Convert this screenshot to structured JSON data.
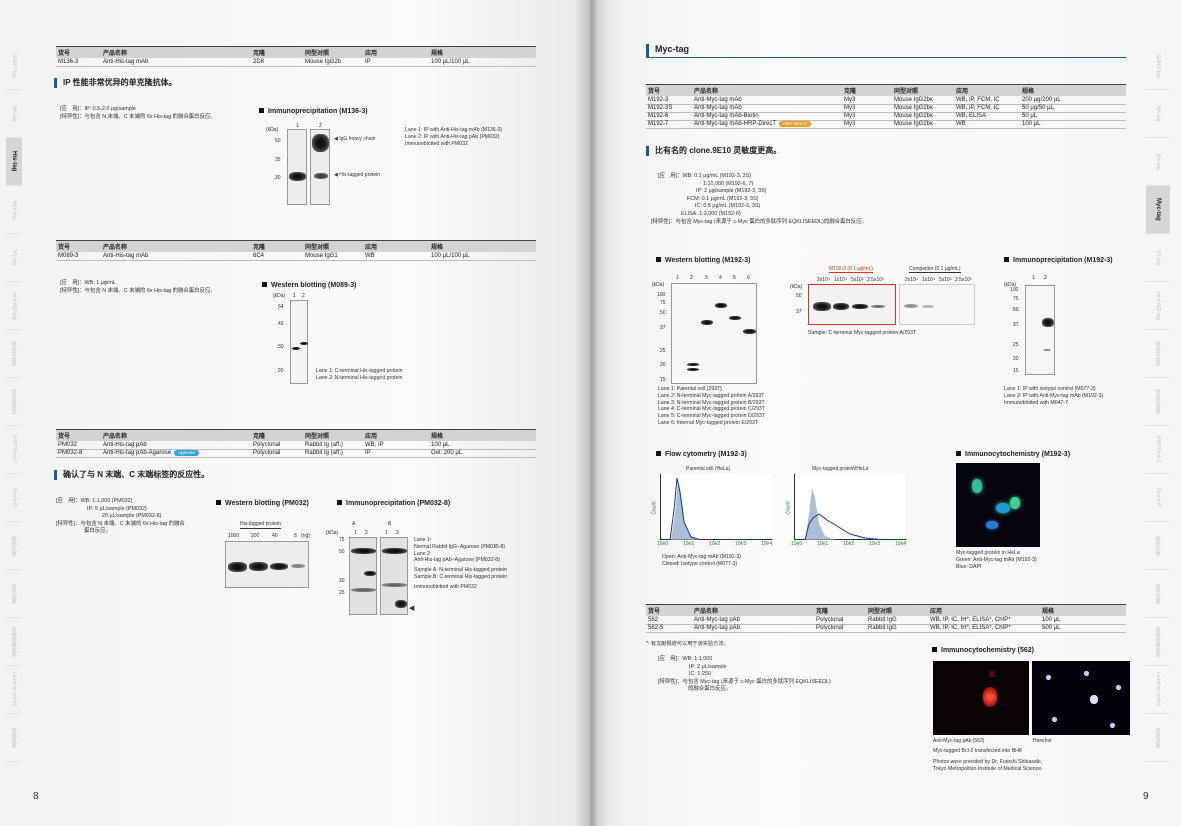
{
  "left_page": {
    "page_number": "8",
    "side_tabs": [
      "SUMO-tag",
      "HA-tag",
      "His-tag",
      "Myc-tag",
      "V5-tag",
      "mini-AID-tag",
      "蛍光蛋白質",
      "蛋白質標識",
      "HRP-DirecT",
      "Direct-IP",
      "精制抗体",
      "研究試薬",
      "実験関連試薬",
      "Loading control",
      "関連試薬"
    ],
    "active_tab": "His-tag",
    "table1": {
      "headers": [
        "货号",
        "产品名称",
        "克隆",
        "同型对照",
        "应用",
        "规格"
      ],
      "rows": [
        [
          "M136-3",
          "Anti-His-tag mAb",
          "2D8",
          "Mouse IgG2b",
          "IP",
          "100 μL/100 μL"
        ]
      ]
    },
    "heading1": "IP 性能非常优异的单克隆抗体。",
    "app1": [
      "[应　用]：IP: 0.5-2.0 μg/sample",
      "[特异性]：与包含 N 末端、C 末端的 6x His-tag 的融合蛋白反应。"
    ],
    "fig1": {
      "title": "Immunoprecipitation (M136-3)",
      "kda": "(kDa)",
      "markers": [
        "50",
        "35",
        "30"
      ],
      "lanes": [
        "1",
        "2"
      ],
      "arrows": [
        "IgG heavy chain",
        "His-tagged protein"
      ],
      "caption": [
        "Lane 1: IP with Anti-His-tag mAb (M136-3)",
        "Lane 2: IP with Anti-His-tag pAb (PM032)",
        "Immunoblotted with PM032"
      ]
    },
    "table2": {
      "headers": [
        "货号",
        "产品名称",
        "克隆",
        "同型对照",
        "应用",
        "规格"
      ],
      "rows": [
        [
          "M089-3",
          "Anti-His-tag mAb",
          "6C4",
          "Mouse IgG1",
          "WB",
          "100 μL/100 μL"
        ]
      ]
    },
    "app2": [
      "[应　用]：WB: 1 μg/mL",
      "[特异性]：与包含 N 末端、C 末端的 6x His-tag 的融合蛋白反应。"
    ],
    "fig2": {
      "title": "Western blotting (M089-3)",
      "kda": "(kDa)",
      "markers": [
        "64",
        "43",
        "30",
        "20"
      ],
      "lanes": [
        "1",
        "2"
      ],
      "caption": [
        "Lane 1: C-terminal His-tagged protein",
        "Lane 2: N-terminal His-tagged protein"
      ]
    },
    "table3": {
      "headers": [
        "货号",
        "产品名称",
        "克隆",
        "同型对照",
        "应用",
        "规格"
      ],
      "rows": [
        [
          "PM032",
          "Anti-His-tag pAb",
          "Polyclonal",
          "Rabbit Ig (aff.)",
          "WB, IP",
          "100 μL"
        ],
        [
          "PM032-8",
          "Anti-His-tag pAb-Agarose",
          "Polyclonal",
          "Rabbit Ig (aff.)",
          "IP",
          "Gel: 200 μL"
        ]
      ],
      "badge": "Agarose",
      "badge_color": "#3aa0d8"
    },
    "heading3": "确认了与 N 末端、C 末端标签的反应性。",
    "app3": [
      "[应　用]：WB: 1:1,000 (PM032)",
      "IP: 5 μL/sample (PM032)",
      "20 μL/sample (PM032-8)",
      "[特异性]：与包含 N 末端、C 末端的 6x His-tag 的融合",
      "蛋白反应。"
    ],
    "fig3": {
      "title": "Western blotting (PM032)",
      "header": "His-tagged protein",
      "lanes": [
        "1000",
        "200",
        "40",
        "8",
        "(ng)"
      ]
    },
    "fig4": {
      "title": "Immunoprecipitation (PM032-8)",
      "kda": "(kDa)",
      "markers": [
        "75",
        "50",
        "30",
        "25"
      ],
      "groups": [
        "A",
        "B"
      ],
      "lanes": [
        "1",
        "2",
        "1",
        "2"
      ],
      "caption": [
        "Lane 1:",
        "Normal Rabbit IgG–Agarose (PM035-8)",
        "Lane 2:",
        "Anti-His-tag pAb–Agarose (PM032-8)",
        "",
        "Sample A: N-terminal His-tagged protein",
        "Sample B: C-terminal His-tagged protein",
        "",
        "Immunoblotted with PM032"
      ]
    }
  },
  "right_page": {
    "page_number": "9",
    "active_tab": "Myc-tag",
    "section_title": "Myc-tag",
    "table1": {
      "headers": [
        "货号",
        "产品名称",
        "克隆",
        "同型对照",
        "应用",
        "规格"
      ],
      "rows": [
        [
          "M192-3",
          "Anti-Myc-tag mAb",
          "My3",
          "Mouse IgG2bκ",
          "WB, IP, FCM, IC",
          "200 μg/200 μL"
        ],
        [
          "M192-3S",
          "Anti-Myc-tag mAb",
          "My3",
          "Mouse IgG2bκ",
          "WB, IP, FCM, IC",
          "50 μg/50 μL"
        ],
        [
          "M192-6",
          "Anti-Myc-tag mAb-Biotin",
          "My3",
          "Mouse IgG2bκ",
          "WB, ELISA",
          "50 μL"
        ],
        [
          "M192-7",
          "Anti-Myc-tag mAb-HRP-DirecT",
          "My3",
          "Mouse IgG2bκ",
          "WB",
          "100 μL"
        ]
      ],
      "badge": "HRP-DirecT",
      "badge_color": "#f0a020"
    },
    "heading1": "比有名的 clone.9E10 灵敏度更高。",
    "app1": [
      "[应　用]：WB: 0.1 μg/mL (M192-3, 3S)",
      "1:10,000 (M192-6, 7)",
      "IP: 2 μg/sample (M192-3, 3S)",
      "FCM: 0.1 μg/mL (M192-3, 3S)",
      "IC: 0.5 μg/mL (M192-3, 3S)",
      "ELISA: 1:2,000 (M192-6)",
      "[特异性]：与包含 Myc-tag (来源于 c-Myc 蛋白的多肽序列 EQKLISEEDL)的融合蛋白反应。"
    ],
    "fig_wb": {
      "title": "Western blotting (M192-3)",
      "kda": "(kDa)",
      "markers": [
        "100",
        "75",
        "50",
        "37",
        "25",
        "20",
        "15"
      ],
      "lanes": [
        "1",
        "2",
        "3",
        "4",
        "5",
        "6"
      ],
      "caption": [
        "Lane 1: Parental cell (293T)",
        "Lane 2: N-terminal Myc-tagged protein A/293T",
        "Lane 3: N-terminal Myc-tagged protein B/293T",
        "Lane 4: C-terminal Myc-tagged protein C/293T",
        "Lane 5: C-terminal Myc-tagged protein D/293T",
        "Lane 6: Internal Myc-tagged protein E/293T"
      ]
    },
    "fig_comp": {
      "group1": "M192-3 (0.1 μg/mL)",
      "group2": "Competitor (0.1 μg/mL)",
      "dilutions": [
        "2x10⁴",
        "1x10⁴",
        "5x10³",
        "2.5x10³"
      ],
      "kda": "(kDa)",
      "markers": [
        "50",
        "37"
      ],
      "caption": "Sample: C-terminal Myc-tagged protein A/293T",
      "highlight_color": "#d0381e"
    },
    "fig_ip": {
      "title": "Immunoprecipitation (M192-3)",
      "kda": "(kDa)",
      "markers": [
        "100",
        "75",
        "50",
        "37",
        "25",
        "20",
        "15"
      ],
      "lanes": [
        "1",
        "2"
      ],
      "caption": [
        "Lane 1: IP with isotype control (M077-3)",
        "Lane 2: IP with Anti-Myc-tag mAb (M192-3)",
        "Immunoblotted with M047-7"
      ]
    },
    "fig_flow": {
      "title": "Flow cytometry (M192-3)",
      "panel1": "Parental cell (HeLa)",
      "panel2": "Myc-tagged protein/HeLa",
      "xticks": [
        "10e0",
        "10e1",
        "10e2",
        "10e3",
        "10e4"
      ],
      "ylabel": "Count",
      "caption": [
        "Open: Anti-Myc-tag mAb (M192-3)",
        "Closed: Isotype control (M077-3)"
      ]
    },
    "fig_icc": {
      "title": "Immunocytochemistry (M192-3)",
      "caption": [
        "Myc-tagged protein in HeLa",
        "Green: Anti-Myc-tag mAb (M192-3)",
        "Blue: DAPI"
      ]
    },
    "table2": {
      "headers": [
        "货号",
        "产品名称",
        "克隆",
        "同型对照",
        "应用",
        "规格"
      ],
      "rows": [
        [
          "562",
          "Anti-Myc-tag pAb",
          "Polyclonal",
          "Rabbit IgG",
          "WB, IP, IC, IH*, ELISA*, ChIP*",
          "100 μL"
        ],
        [
          "562-5",
          "Anti-Myc-tag pAb",
          "Polyclonal",
          "Rabbit IgG",
          "WB, IP, IC, IH*, ELISA*, ChIP*",
          "500 μL"
        ]
      ]
    },
    "footnote": "*: 有文献报道可以用于该实验方法。",
    "app2": [
      "[应　用]：WB: 1:1,000",
      "IP: 2 μL/sample",
      "IC: 1:250",
      "[特异性]：与包含 Myc-tag (来源于 c-Myc 蛋白的多肽序列 EQKLISEEDL)",
      "的融合蛋白反应。"
    ],
    "fig_icc2": {
      "title": "Immunocytochemistry (562)",
      "label1": "Anti-Myc-tag pAb (562)",
      "label2": "Hoechst",
      "caption": [
        "Myc-tagged Bcl-2 transfected into BHK",
        "",
        "Photos were provided by Dr. Futoshi Shibasaki,",
        "Tokyo Metropolitan Institute of Medical Science."
      ]
    }
  }
}
